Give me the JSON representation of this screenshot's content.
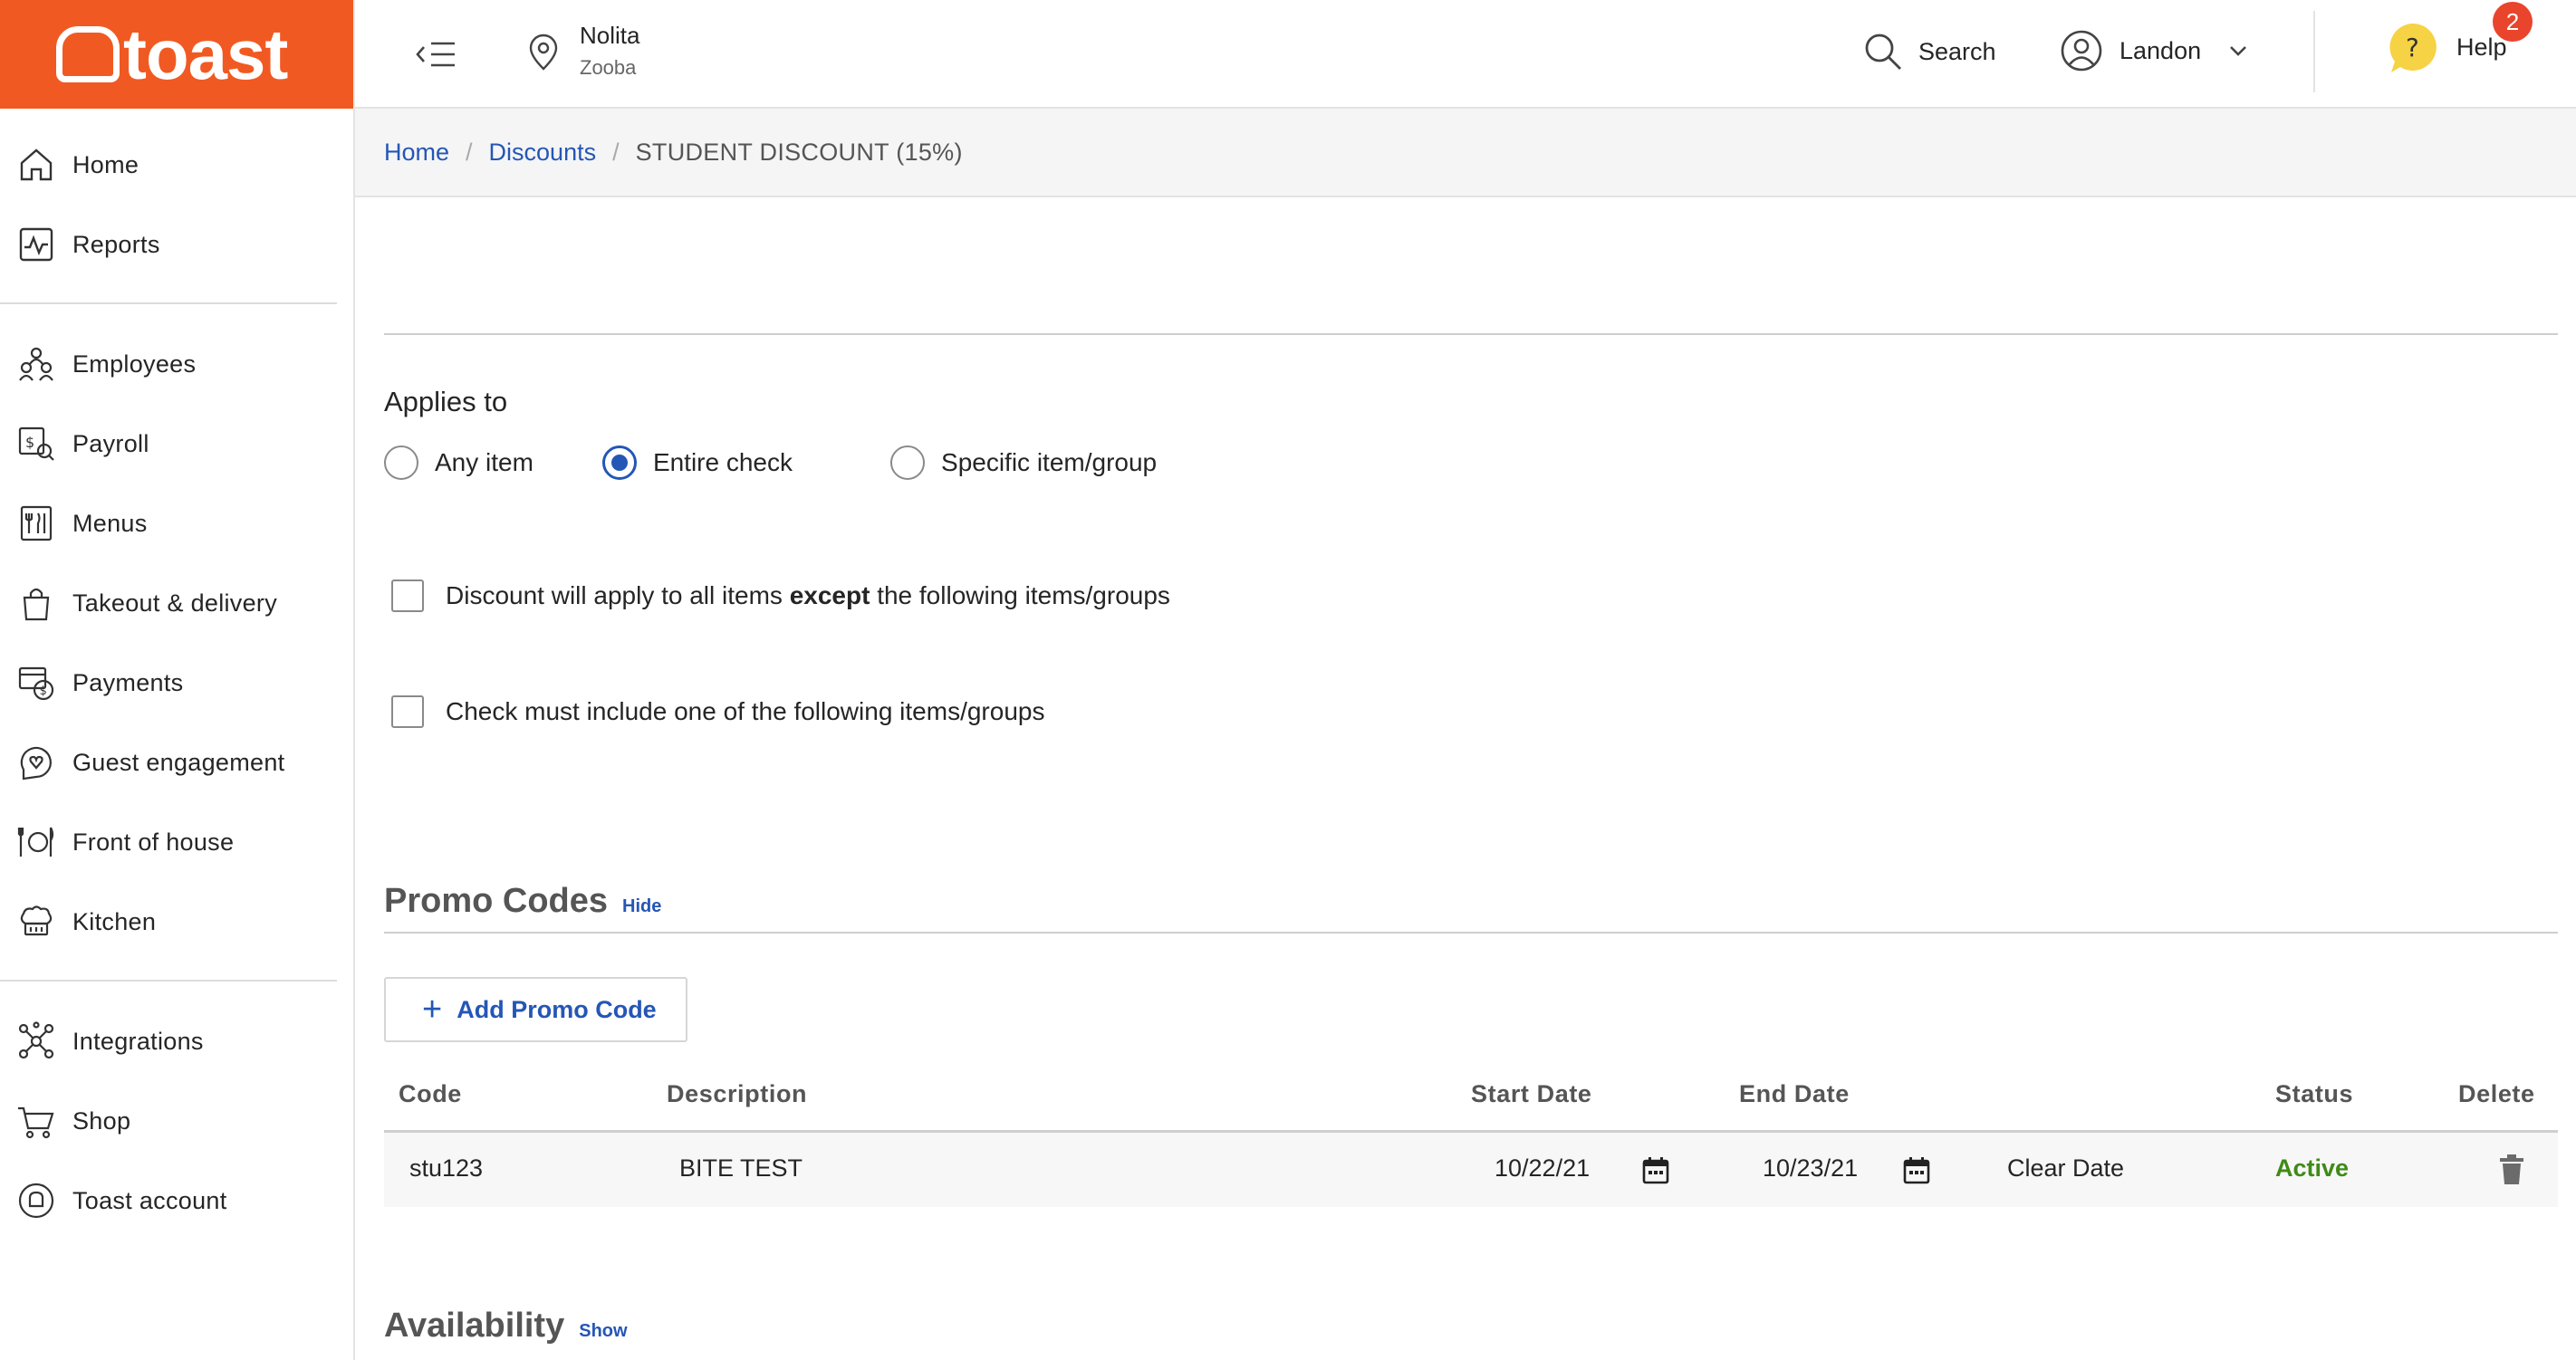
{
  "brand": {
    "name": "toast",
    "color": "#f05a22"
  },
  "sidebar": {
    "groups": [
      [
        {
          "label": "Home",
          "icon": "home-icon"
        },
        {
          "label": "Reports",
          "icon": "reports-icon"
        }
      ],
      [
        {
          "label": "Employees",
          "icon": "employees-icon"
        },
        {
          "label": "Payroll",
          "icon": "payroll-icon"
        },
        {
          "label": "Menus",
          "icon": "menus-icon"
        },
        {
          "label": "Takeout & delivery",
          "icon": "takeout-bag-icon"
        },
        {
          "label": "Payments",
          "icon": "payments-icon"
        },
        {
          "label": "Guest engagement",
          "icon": "guest-engagement-icon"
        },
        {
          "label": "Front of house",
          "icon": "front-of-house-icon"
        },
        {
          "label": "Kitchen",
          "icon": "kitchen-icon"
        }
      ],
      [
        {
          "label": "Integrations",
          "icon": "integrations-icon"
        },
        {
          "label": "Shop",
          "icon": "shop-cart-icon"
        },
        {
          "label": "Toast account",
          "icon": "toast-account-icon"
        }
      ]
    ]
  },
  "topbar": {
    "location_name": "Nolita",
    "location_sub": "Zooba",
    "search_label": "Search",
    "user_name": "Landon",
    "help_label": "Help",
    "help_badge": "2"
  },
  "breadcrumb": {
    "home": "Home",
    "discounts": "Discounts",
    "current": "STUDENT DISCOUNT (15%)",
    "separator": "/"
  },
  "applies_to": {
    "title": "Applies to",
    "options": [
      "Any item",
      "Entire check",
      "Specific item/group"
    ],
    "selected": "Entire check"
  },
  "checks": {
    "except_prefix": "Discount will apply to all items ",
    "except_bold": "except",
    "except_suffix": " the following items/groups",
    "include_label": "Check must include one of the following items/groups"
  },
  "promo_codes": {
    "title": "Promo Codes",
    "toggle": "Hide",
    "add_button": "Add Promo Code",
    "columns": {
      "code": "Code",
      "description": "Description",
      "start": "Start Date",
      "end": "End Date",
      "status": "Status",
      "delete": "Delete"
    },
    "rows": [
      {
        "code": "stu123",
        "description": "BITE TEST",
        "start": "10/22/21",
        "end": "10/23/21",
        "clear": "Clear Date",
        "status": "Active"
      }
    ]
  },
  "availability": {
    "title": "Availability",
    "toggle": "Show"
  },
  "colors": {
    "link": "#2456b6",
    "active_status": "#3f8a17",
    "badge": "#e8452c",
    "help_bubble": "#f6d245"
  }
}
